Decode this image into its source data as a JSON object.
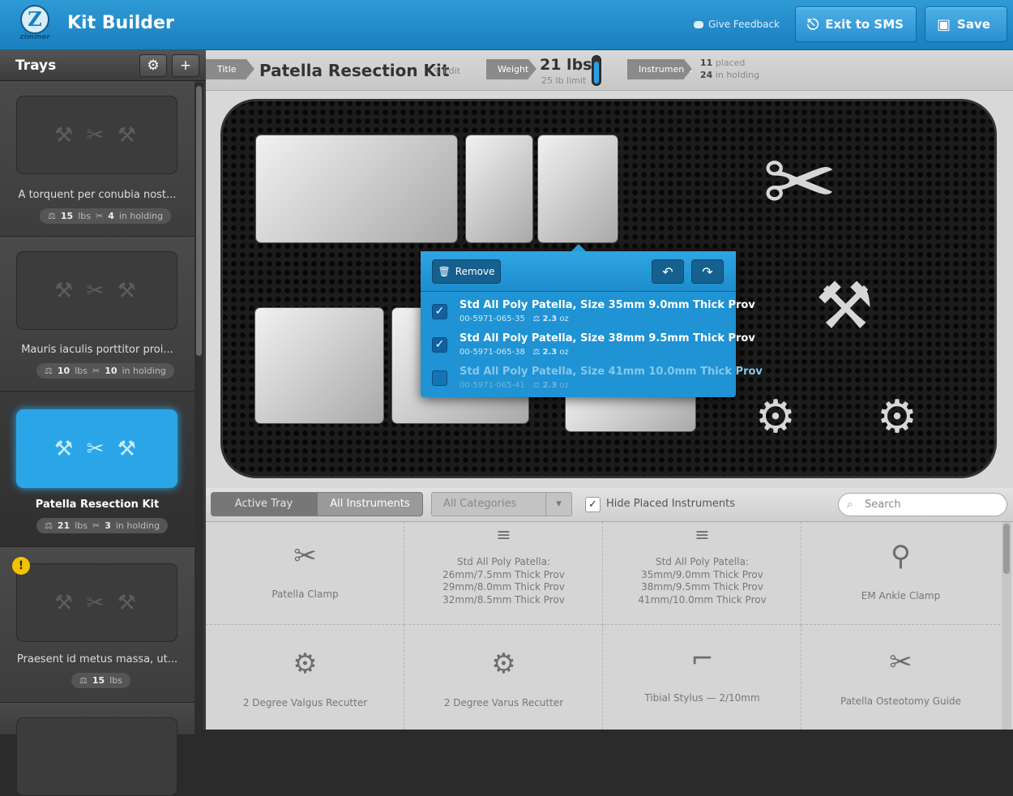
{
  "header": {
    "brand": "zimmer",
    "brand_icon": "Z",
    "title": "Kit Builder",
    "feedback_label": "Give Feedback",
    "exit_label": "Exit to SMS",
    "save_label": "Save",
    "exit_icon": "exit-door-icon",
    "save_icon": "floppy-disk-icon",
    "accent_color": "#1f93d4"
  },
  "sidebar": {
    "title": "Trays",
    "settings_icon": "⚙",
    "add_icon": "+",
    "trays": [
      {
        "name": "A torquent per conubia nost...",
        "weight": "15",
        "weight_unit": "lbs",
        "holding": "4",
        "holding_label": "in holding",
        "selected": false,
        "warning": false
      },
      {
        "name": "Mauris iaculis porttitor proi...",
        "weight": "10",
        "weight_unit": "lbs",
        "holding": "10",
        "holding_label": "in holding",
        "selected": false,
        "warning": false
      },
      {
        "name": "Patella Resection Kit",
        "weight": "21",
        "weight_unit": "lbs",
        "holding": "3",
        "holding_label": "in holding",
        "selected": true,
        "warning": false
      },
      {
        "name": "Praesent id metus massa, ut...",
        "weight": "15",
        "weight_unit": "lbs",
        "selected": false,
        "warning": true,
        "warning_icon": "!"
      }
    ]
  },
  "info": {
    "title_tag": "Title",
    "kit_name": "Patella Resection Kit",
    "edit_label": "Edit",
    "weight_tag": "Weight",
    "weight_value": "21 lbs",
    "weight_limit": "25 lb limit",
    "weight_fraction": 0.84,
    "instruments_tag": "Instruments",
    "placed_count": "11",
    "placed_label": "placed",
    "holding_count": "24",
    "holding_label": "in holding"
  },
  "popover": {
    "remove_label": "Remove",
    "undo_icon": "undo-icon",
    "redo_icon": "redo-icon",
    "items": [
      {
        "name": "Std All Poly Patella, Size 35mm 9.0mm Thick Prov",
        "code": "00-5971-065-35",
        "weight": "2.3",
        "unit": "oz",
        "checked": true
      },
      {
        "name": "Std All Poly Patella, Size 38mm 9.5mm Thick Prov",
        "code": "00-5971-065-38",
        "weight": "2.3",
        "unit": "oz",
        "checked": true
      },
      {
        "name": "Std All Poly Patella, Size 41mm 10.0mm Thick Prov",
        "code": "00-5971-065-41",
        "weight": "2.3",
        "unit": "oz",
        "checked": false
      }
    ]
  },
  "filters": {
    "active_tray": "Active Tray",
    "all_instruments": "All Instruments",
    "category": "All Categories",
    "hide_placed": "Hide Placed Instruments",
    "hide_placed_checked": true,
    "search_placeholder": "Search"
  },
  "library": [
    {
      "label": "Patella Clamp",
      "icon": "patella-clamp-icon"
    },
    {
      "label": "Std All Poly Patella:\n26mm/7.5mm Thick Prov\n29mm/8.0mm Thick Prov\n32mm/8.5mm Thick Prov",
      "icon": "patella-stack-icon"
    },
    {
      "label": "Std All Poly Patella:\n35mm/9.0mm Thick Prov\n38mm/9.5mm Thick Prov\n41mm/10.0mm Thick Prov",
      "icon": "patella-stack-icon"
    },
    {
      "label": "EM Ankle Clamp",
      "icon": "ankle-clamp-icon"
    },
    {
      "label": "2 Degree Valgus Recutter",
      "icon": "recutter-icon"
    },
    {
      "label": "2 Degree Varus Recutter",
      "icon": "recutter-icon"
    },
    {
      "label": "Tibial Stylus — 2/10mm",
      "icon": "stylus-icon"
    },
    {
      "label": "Patella Osteotomy Guide",
      "icon": "osteotomy-guide-icon"
    }
  ]
}
